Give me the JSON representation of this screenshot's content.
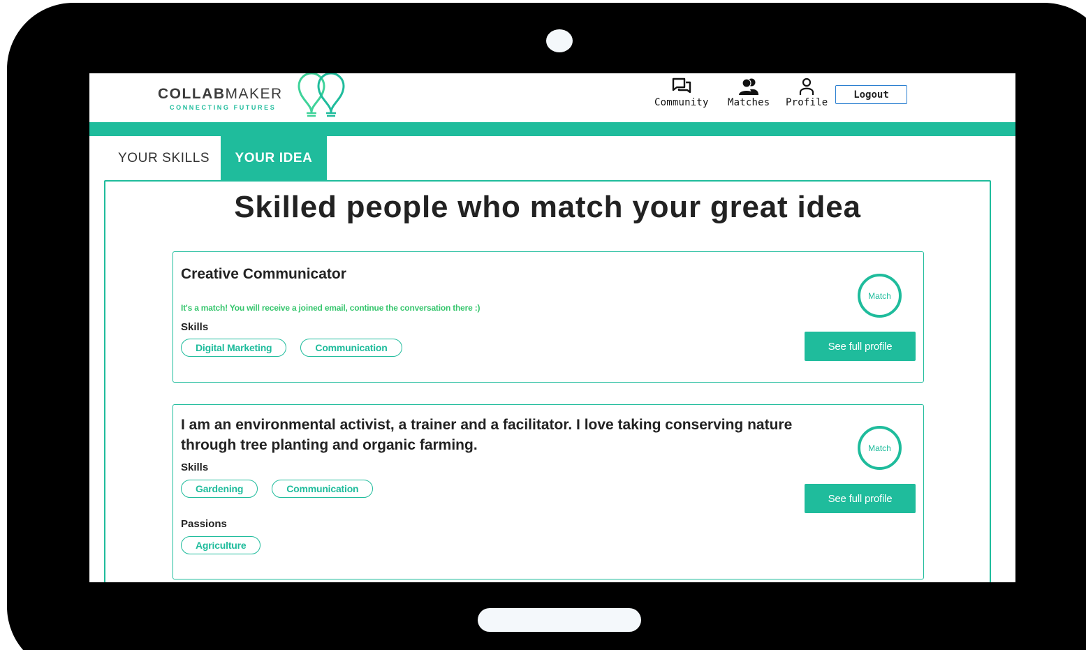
{
  "brand": {
    "name_bold": "COLLAB",
    "name_light": "MAKER",
    "tagline": "CONNECTING FUTURES",
    "accent_color": "#1fbc9c"
  },
  "nav": {
    "items": [
      {
        "label": "Community",
        "icon": "chat-bubbles-icon"
      },
      {
        "label": "Matches",
        "icon": "people-icon"
      },
      {
        "label": "Profile",
        "icon": "person-icon"
      }
    ],
    "logout_label": "Logout"
  },
  "tabs": [
    {
      "label": "YOUR SKILLS",
      "active": false
    },
    {
      "label": "YOUR IDEA",
      "active": true
    }
  ],
  "page_title": "Skilled people who match your great idea",
  "cards": [
    {
      "title": "Creative Communicator",
      "match_message": "It's a match! You will receive a joined email, continue the conversation there :)",
      "skills_label": "Skills",
      "skills": [
        "Digital Marketing",
        "Communication"
      ],
      "match_label": "Match",
      "profile_button": "See full profile"
    },
    {
      "title": "I am an environmental activist, a trainer and a facilitator. I love taking conserving nature through tree planting and organic farming.",
      "skills_label": "Skills",
      "skills": [
        "Gardening",
        "Communication"
      ],
      "passions_label": "Passions",
      "passions": [
        "Agriculture"
      ],
      "match_label": "Match",
      "profile_button": "See full profile"
    }
  ]
}
